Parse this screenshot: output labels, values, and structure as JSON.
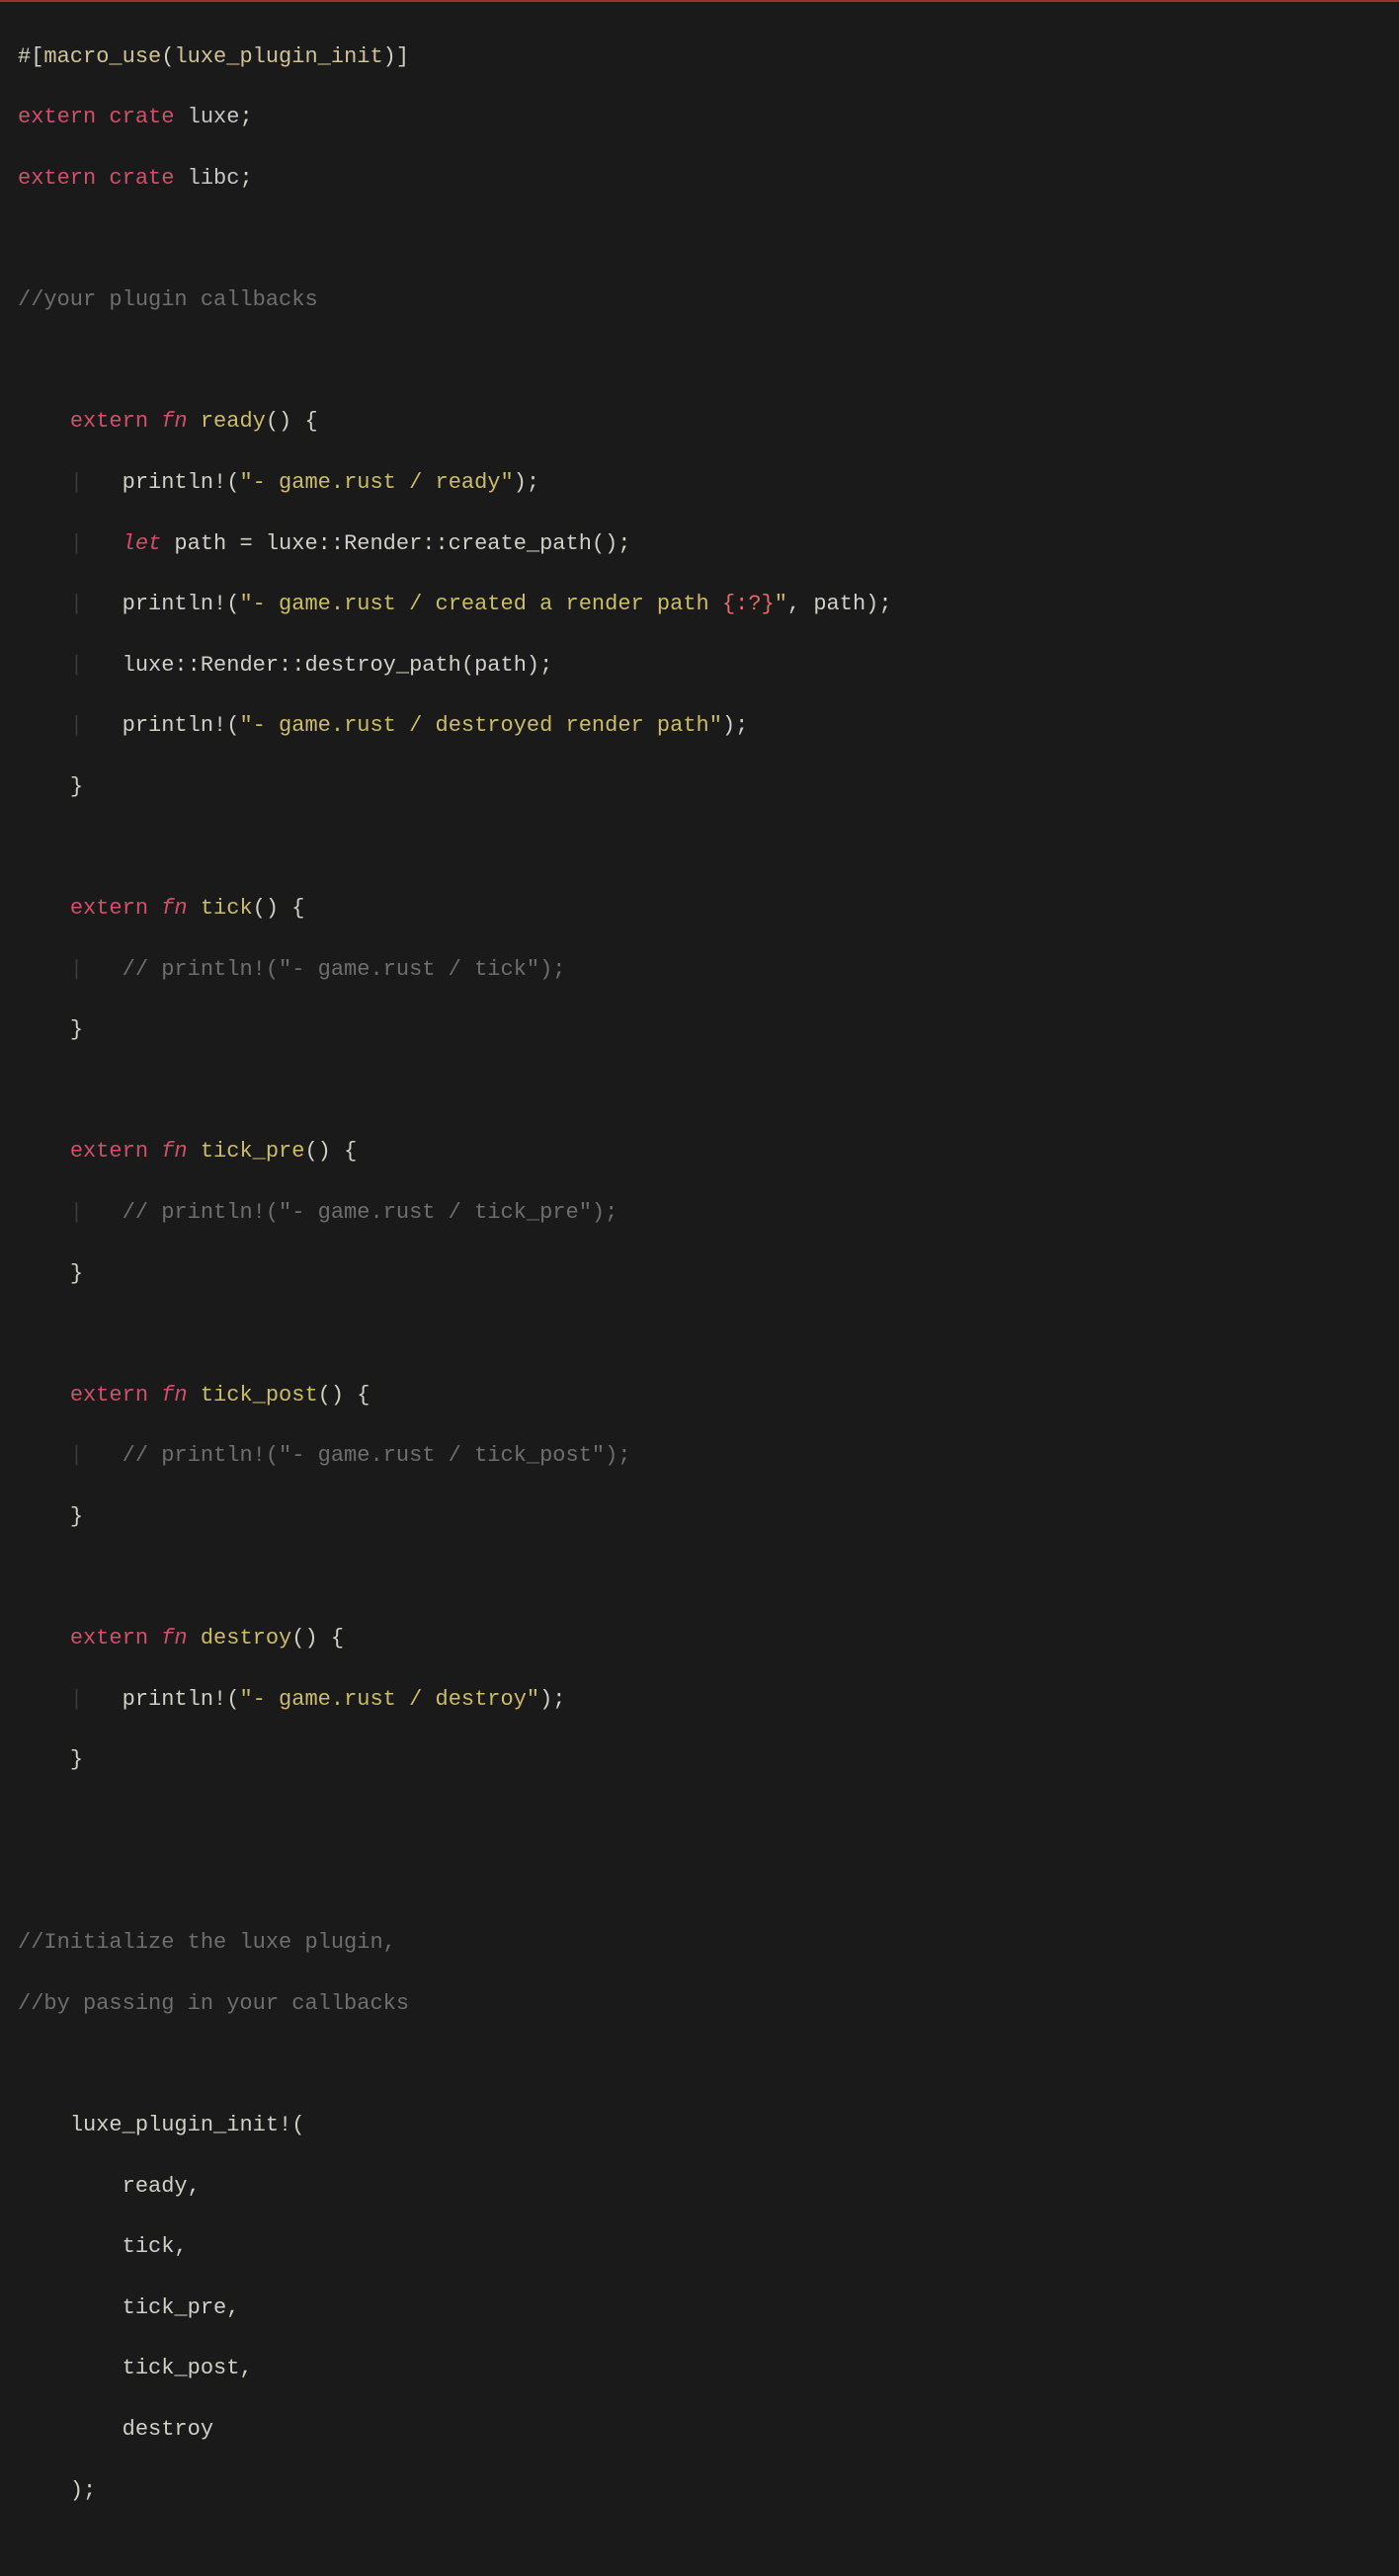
{
  "l1": {
    "hash": "#[",
    "macro": "macro_use",
    "paren1": "(",
    "arg": "luxe_plugin_init",
    "paren2": ")]"
  },
  "l2": {
    "extern": "extern",
    "crate": "crate",
    "name": "luxe",
    "semi": ";"
  },
  "l3": {
    "extern": "extern",
    "crate": "crate",
    "name": "libc",
    "semi": ";"
  },
  "l5": {
    "text": "//your plugin callbacks"
  },
  "fn_ready": {
    "extern": "extern",
    "fn": "fn",
    "name": "ready",
    "sig": "() {",
    "b1a": "println!(",
    "b1s": "\"- game.rust / ready\"",
    "b1e": ");",
    "b2let": "let",
    "b2rest": " path = luxe::Render::create_path();",
    "b3a": "println!(",
    "b3s": "\"- game.rust / created a render path ",
    "b3fmt": "{:?}",
    "b3s2": "\"",
    "b3e": ", path);",
    "b4": "luxe::Render::destroy_path(path);",
    "b5a": "println!(",
    "b5s": "\"- game.rust / destroyed render path\"",
    "b5e": ");",
    "close": "}"
  },
  "fn_tick": {
    "extern": "extern",
    "fn": "fn",
    "name": "tick",
    "sig": "() {",
    "cmt": "// println!(\"- game.rust / tick\");",
    "close": "}"
  },
  "fn_tick_pre": {
    "extern": "extern",
    "fn": "fn",
    "name": "tick_pre",
    "sig": "() {",
    "cmt": "// println!(\"- game.rust / tick_pre\");",
    "close": "}"
  },
  "fn_tick_post": {
    "extern": "extern",
    "fn": "fn",
    "name": "tick_post",
    "sig": "() {",
    "cmt": "// println!(\"- game.rust / tick_post\");",
    "close": "}"
  },
  "fn_destroy": {
    "extern": "extern",
    "fn": "fn",
    "name": "destroy",
    "sig": "() {",
    "b1a": "println!(",
    "b1s": "\"- game.rust / destroy\"",
    "b1e": ");",
    "close": "}"
  },
  "cmt_init1": "//Initialize the luxe plugin,",
  "cmt_init2": "//by passing in your callbacks",
  "init": {
    "open": "luxe_plugin_init!(",
    "a1": "ready,",
    "a2": "tick,",
    "a3": "tick_pre,",
    "a4": "tick_post,",
    "a5": "destroy",
    "close": ");"
  },
  "sp4": "    ",
  "sp8": "        ",
  "guide": "|   "
}
